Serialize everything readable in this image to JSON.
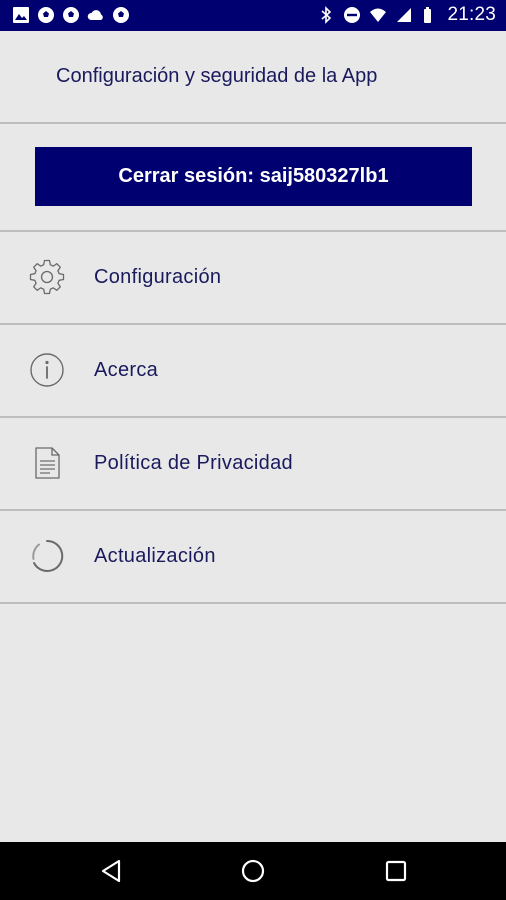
{
  "status_bar": {
    "time": "21:23",
    "left_icons": [
      "image-icon",
      "soccer-ball-icon",
      "soccer-ball-icon",
      "cloud-icon",
      "soccer-ball-icon"
    ],
    "right_icons": [
      "bluetooth-icon",
      "do-not-disturb-icon",
      "wifi-icon",
      "signal-icon",
      "battery-icon"
    ]
  },
  "header": {
    "title": "Configuración y seguridad de la App"
  },
  "logout": {
    "label": "Cerrar sesión: saij580327lb1"
  },
  "menu": {
    "items": [
      {
        "label": "Configuración",
        "icon": "gear-icon"
      },
      {
        "label": "Acerca",
        "icon": "info-icon"
      },
      {
        "label": "Política de Privacidad",
        "icon": "document-icon"
      },
      {
        "label": "Actualización",
        "icon": "refresh-icon"
      }
    ]
  },
  "nav_bar": {
    "buttons": [
      "back-icon",
      "home-icon",
      "recents-icon"
    ]
  },
  "colors": {
    "accent": "#000070",
    "background": "#e8e8e8",
    "text": "#1a1a5c",
    "divider": "#bdbdbd"
  }
}
